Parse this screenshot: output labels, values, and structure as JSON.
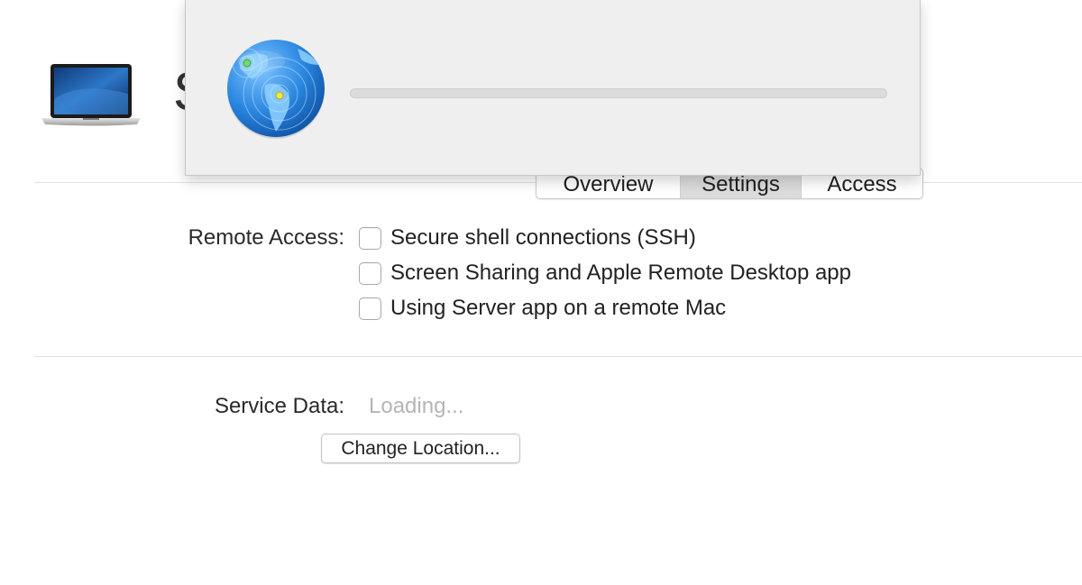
{
  "header": {
    "title_visible": "S",
    "icon": "macbook-icon"
  },
  "tabs": [
    {
      "label": "Overview",
      "selected": false
    },
    {
      "label": "Settings",
      "selected": true
    },
    {
      "label": "Access",
      "selected": false
    }
  ],
  "remote_access": {
    "label": "Remote Access:",
    "options": [
      {
        "label": "Secure shell connections (SSH)",
        "checked": false
      },
      {
        "label": "Screen Sharing and Apple Remote Desktop app",
        "checked": false
      },
      {
        "label": "Using Server app on a remote Mac",
        "checked": false
      }
    ]
  },
  "service_data": {
    "label": "Service Data:",
    "value": "Loading...",
    "change_button": "Change Location..."
  },
  "progress_sheet": {
    "icon": "server-globe-icon",
    "progress": 0
  },
  "colors": {
    "selected_tab": "#dcdcdc",
    "placeholder_text": "#b5b5b5",
    "sheet_background": "#efefef"
  }
}
